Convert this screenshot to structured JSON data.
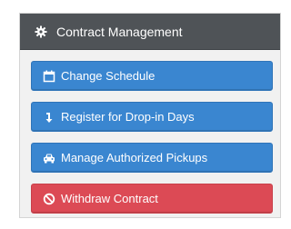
{
  "panel": {
    "title": "Contract Management",
    "title_icon": "gear-icon"
  },
  "buttons": [
    {
      "label": "Change Schedule",
      "icon": "calendar-icon",
      "color": "#3a86d0"
    },
    {
      "label": "Register for Drop-in Days",
      "icon": "arrow-down-icon",
      "color": "#3a86d0"
    },
    {
      "label": "Manage Authorized Pickups",
      "icon": "car-icon",
      "color": "#3a86d0"
    },
    {
      "label": "Withdraw Contract",
      "icon": "ban-icon",
      "color": "#dc4a55"
    }
  ]
}
